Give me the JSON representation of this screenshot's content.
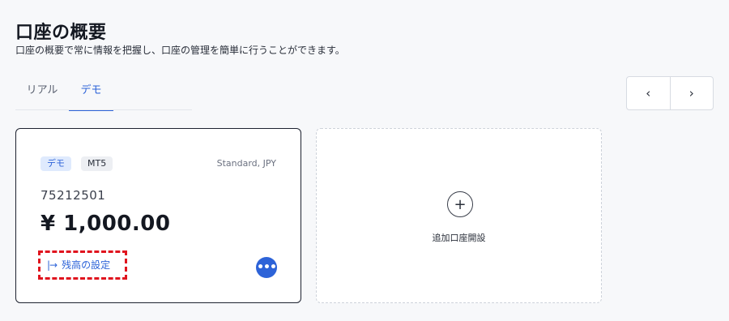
{
  "header": {
    "title": "口座の概要",
    "subtitle": "口座の概要で常に情報を把握し、口座の管理を簡単に行うことができます。"
  },
  "tabs": [
    {
      "label": "リアル",
      "active": false
    },
    {
      "label": "デモ",
      "active": true
    }
  ],
  "nav": {
    "prev_icon": "‹",
    "next_icon": "›"
  },
  "account_card": {
    "badges": [
      "デモ",
      "MT5"
    ],
    "account_type": "Standard, JPY",
    "account_number": "75212501",
    "balance": "¥ 1,000.00",
    "balance_setting_icon": "|→",
    "balance_setting_label": "残高の設定",
    "more_icon": "•••"
  },
  "add_account": {
    "icon": "+",
    "label": "追加口座開設"
  },
  "colors": {
    "accent": "#2d63d8",
    "highlight": "#e0141e"
  }
}
